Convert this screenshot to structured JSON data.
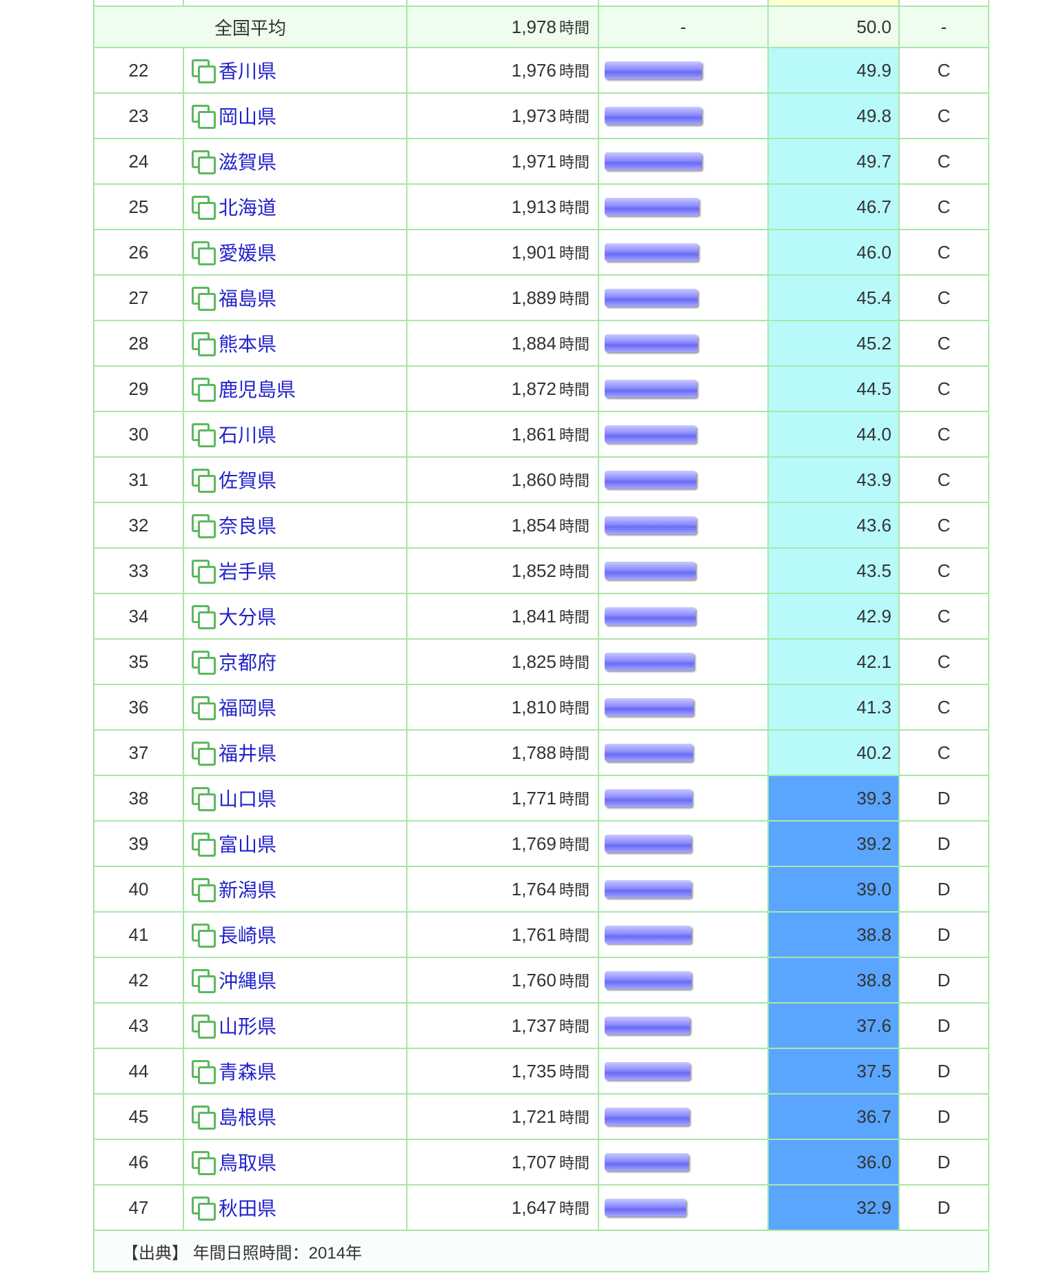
{
  "average": {
    "label": "全国平均",
    "value": "1,978",
    "unit": "時間",
    "bar": "-",
    "deviation": "50.0",
    "grade": "-"
  },
  "unit": "時間",
  "rows": [
    {
      "rank": "22",
      "name": "香川県",
      "value": "1,976",
      "deviation": "49.9",
      "grade": "C"
    },
    {
      "rank": "23",
      "name": "岡山県",
      "value": "1,973",
      "deviation": "49.8",
      "grade": "C"
    },
    {
      "rank": "24",
      "name": "滋賀県",
      "value": "1,971",
      "deviation": "49.7",
      "grade": "C"
    },
    {
      "rank": "25",
      "name": "北海道",
      "value": "1,913",
      "deviation": "46.7",
      "grade": "C"
    },
    {
      "rank": "26",
      "name": "愛媛県",
      "value": "1,901",
      "deviation": "46.0",
      "grade": "C"
    },
    {
      "rank": "27",
      "name": "福島県",
      "value": "1,889",
      "deviation": "45.4",
      "grade": "C"
    },
    {
      "rank": "28",
      "name": "熊本県",
      "value": "1,884",
      "deviation": "45.2",
      "grade": "C"
    },
    {
      "rank": "29",
      "name": "鹿児島県",
      "value": "1,872",
      "deviation": "44.5",
      "grade": "C"
    },
    {
      "rank": "30",
      "name": "石川県",
      "value": "1,861",
      "deviation": "44.0",
      "grade": "C"
    },
    {
      "rank": "31",
      "name": "佐賀県",
      "value": "1,860",
      "deviation": "43.9",
      "grade": "C"
    },
    {
      "rank": "32",
      "name": "奈良県",
      "value": "1,854",
      "deviation": "43.6",
      "grade": "C"
    },
    {
      "rank": "33",
      "name": "岩手県",
      "value": "1,852",
      "deviation": "43.5",
      "grade": "C"
    },
    {
      "rank": "34",
      "name": "大分県",
      "value": "1,841",
      "deviation": "42.9",
      "grade": "C"
    },
    {
      "rank": "35",
      "name": "京都府",
      "value": "1,825",
      "deviation": "42.1",
      "grade": "C"
    },
    {
      "rank": "36",
      "name": "福岡県",
      "value": "1,810",
      "deviation": "41.3",
      "grade": "C"
    },
    {
      "rank": "37",
      "name": "福井県",
      "value": "1,788",
      "deviation": "40.2",
      "grade": "C"
    },
    {
      "rank": "38",
      "name": "山口県",
      "value": "1,771",
      "deviation": "39.3",
      "grade": "D"
    },
    {
      "rank": "39",
      "name": "富山県",
      "value": "1,769",
      "deviation": "39.2",
      "grade": "D"
    },
    {
      "rank": "40",
      "name": "新潟県",
      "value": "1,764",
      "deviation": "39.0",
      "grade": "D"
    },
    {
      "rank": "41",
      "name": "長崎県",
      "value": "1,761",
      "deviation": "38.8",
      "grade": "D"
    },
    {
      "rank": "42",
      "name": "沖縄県",
      "value": "1,760",
      "deviation": "38.8",
      "grade": "D"
    },
    {
      "rank": "43",
      "name": "山形県",
      "value": "1,737",
      "deviation": "37.6",
      "grade": "D"
    },
    {
      "rank": "44",
      "name": "青森県",
      "value": "1,735",
      "deviation": "37.5",
      "grade": "D"
    },
    {
      "rank": "45",
      "name": "島根県",
      "value": "1,721",
      "deviation": "36.7",
      "grade": "D"
    },
    {
      "rank": "46",
      "name": "鳥取県",
      "value": "1,707",
      "deviation": "36.0",
      "grade": "D"
    },
    {
      "rank": "47",
      "name": "秋田県",
      "value": "1,647",
      "deviation": "32.9",
      "grade": "D"
    }
  ],
  "source": "【出典】 年間日照時間：2014年",
  "colors": {
    "grade_c_bg": "#b8fafa",
    "grade_d_bg": "#5aa6ff",
    "border": "#a8e6a8",
    "link": "#2222cc",
    "icon": "#5cb85c"
  },
  "icons": {
    "prefecture_link": "copy-squares-icon"
  }
}
